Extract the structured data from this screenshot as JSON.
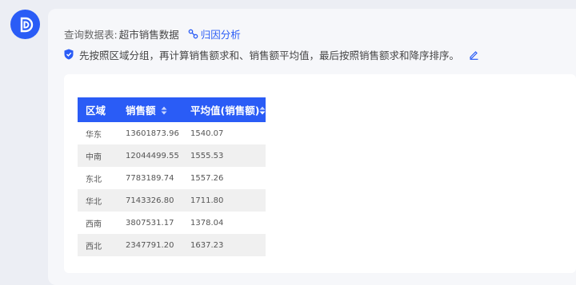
{
  "query": {
    "label": "查询数据表:",
    "table_name": "超市销售数据",
    "attribution_label": "归因分析"
  },
  "description": "先按照区域分组，再计算销售额求和、销售额平均值，最后按照销售额求和降序排序。",
  "table": {
    "columns": [
      "区域",
      "销售额",
      "平均值(销售额)"
    ],
    "rows": [
      [
        "华东",
        "13601873.96",
        "1540.07"
      ],
      [
        "中南",
        "12044499.55",
        "1555.53"
      ],
      [
        "东北",
        "7783189.74",
        "1557.26"
      ],
      [
        "华北",
        "7143326.80",
        "1711.80"
      ],
      [
        "西南",
        "3807531.17",
        "1378.04"
      ],
      [
        "西北",
        "2347791.20",
        "1637.23"
      ]
    ]
  },
  "colors": {
    "accent": "#2a5cf6",
    "header_text": "#ffffff",
    "stripe": "#f0f0f0"
  },
  "icons": {
    "avatar": "logo-icon",
    "attribution": "attribution-icon",
    "shield": "shield-check-icon",
    "edit": "edit-pencil-icon",
    "sort": "sort-icon"
  }
}
